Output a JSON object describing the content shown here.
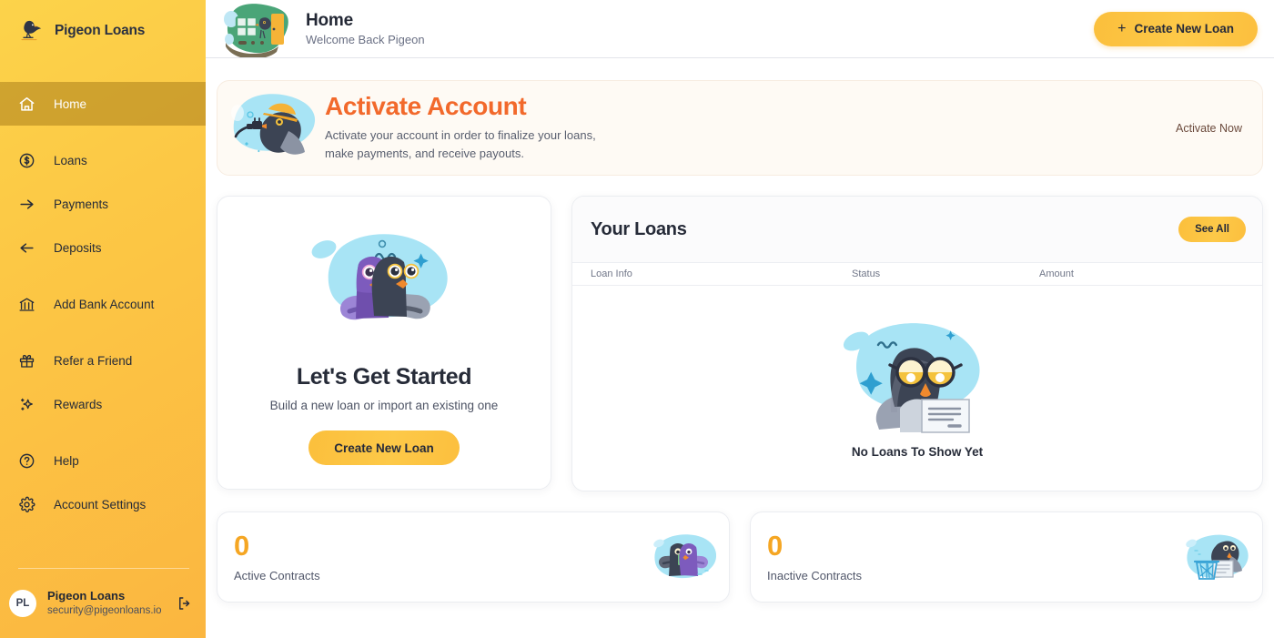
{
  "brand": {
    "name": "Pigeon Loans",
    "logo_icon": "pigeon-logo-icon"
  },
  "sidebar": {
    "items": [
      {
        "label": "Home",
        "icon": "home-icon",
        "active": true
      },
      {
        "label": "Loans",
        "icon": "dollar-circle-icon",
        "active": false
      },
      {
        "label": "Payments",
        "icon": "arrow-right-icon",
        "active": false
      },
      {
        "label": "Deposits",
        "icon": "arrow-left-icon",
        "active": false
      },
      {
        "label": "Add Bank Account",
        "icon": "bank-icon",
        "active": false
      },
      {
        "label": "Refer a Friend",
        "icon": "gift-icon",
        "active": false
      },
      {
        "label": "Rewards",
        "icon": "sparkles-icon",
        "active": false
      },
      {
        "label": "Help",
        "icon": "question-circle-icon",
        "active": false
      },
      {
        "label": "Account Settings",
        "icon": "gear-icon",
        "active": false
      }
    ],
    "profile": {
      "initials": "PL",
      "name": "Pigeon Loans",
      "email": "security@pigeonloans.io",
      "logout_icon": "logout-icon"
    }
  },
  "header": {
    "illustration": "house-door-pigeon-illustration",
    "title": "Home",
    "subtitle": "Welcome Back Pigeon",
    "create_loan_button": "Create New Loan",
    "create_loan_icon": "plus-icon"
  },
  "activate_banner": {
    "illustration": "pigeon-hardhat-plug-illustration",
    "title": "Activate Account",
    "description": "Activate your account in order to finalize your loans, make payments, and receive payouts.",
    "link_label": "Activate Now",
    "title_color": "#f2692b"
  },
  "get_started": {
    "illustration": "two-pigeons-illustration",
    "title": "Let's Get Started",
    "subtitle": "Build a new loan or import an existing one",
    "button_label": "Create New Loan"
  },
  "your_loans": {
    "title": "Your Loans",
    "see_all_label": "See All",
    "columns": [
      "Loan Info",
      "Status",
      "Amount"
    ],
    "rows": [],
    "empty_illustration": "pigeon-glasses-document-illustration",
    "empty_message": "No Loans To Show Yet"
  },
  "stats": [
    {
      "value": "0",
      "label": "Active Contracts",
      "illustration": "pigeons-money-illustration"
    },
    {
      "value": "0",
      "label": "Inactive Contracts",
      "illustration": "pigeon-trash-illustration"
    }
  ],
  "colors": {
    "sidebar_start": "#fcd34a",
    "sidebar_end": "#fbb640",
    "accent": "#fbbf3c",
    "stat_value": "#f5a623",
    "activate_orange": "#f2692b"
  }
}
